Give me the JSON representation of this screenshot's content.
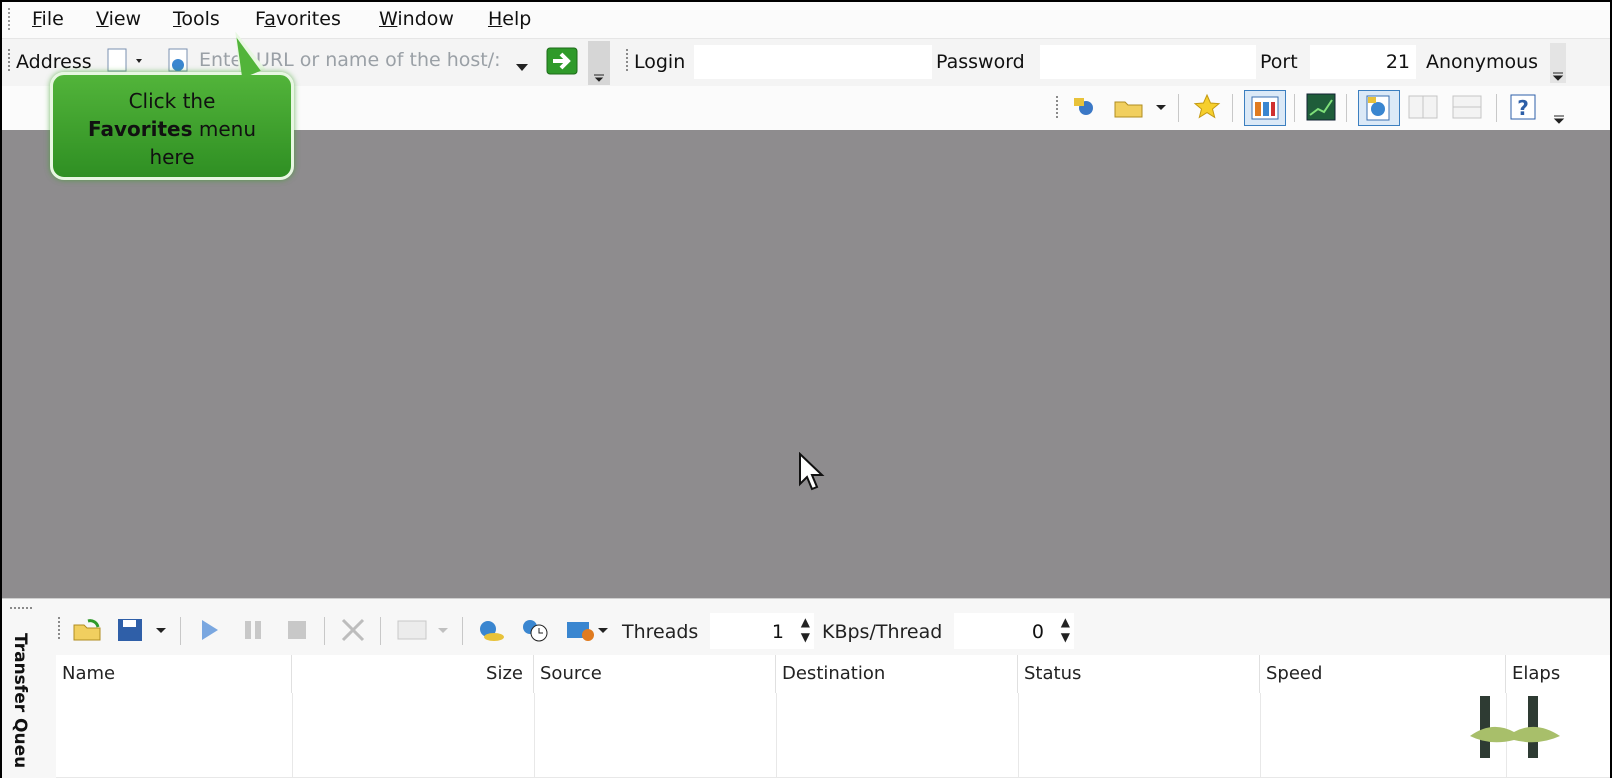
{
  "menu": {
    "items": [
      {
        "label": "File",
        "accel": "F"
      },
      {
        "label": "View",
        "accel": "V"
      },
      {
        "label": "Tools",
        "accel": "T"
      },
      {
        "label": "Favorites",
        "accel": "a"
      },
      {
        "label": "Window",
        "accel": "W"
      },
      {
        "label": "Help",
        "accel": "H"
      }
    ]
  },
  "address_bar": {
    "address_label": "Address",
    "url_placeholder": "Enter URL or name of the host/:",
    "login_label": "Login",
    "login_value": "",
    "password_label": "Password",
    "password_value": "",
    "port_label": "Port",
    "port_value": "21",
    "anonymous_label": "Anonymous"
  },
  "callout": {
    "line1": "Click the",
    "bold": "Favorites",
    "line2_rest": " menu",
    "line3": "here"
  },
  "toolbar_icons": [
    "connect-icon",
    "open-folder-icon",
    "favorites-star-icon",
    "layout-panels-icon",
    "chart-icon",
    "browser-icon",
    "split-vertical-icon",
    "split-horizontal-icon",
    "help-icon"
  ],
  "transfer_queue": {
    "panel_label": "Transfer Queu",
    "threads_label": "Threads",
    "threads_value": "1",
    "kbps_label": "KBps/Thread",
    "kbps_value": "0",
    "columns": [
      "Name",
      "Size",
      "Source",
      "Destination",
      "Status",
      "Speed",
      "Elaps"
    ]
  },
  "colors": {
    "workspace": "#8e8c8e",
    "callout_green": "#3f9f2c",
    "accent_blue": "#3c7fc0"
  }
}
